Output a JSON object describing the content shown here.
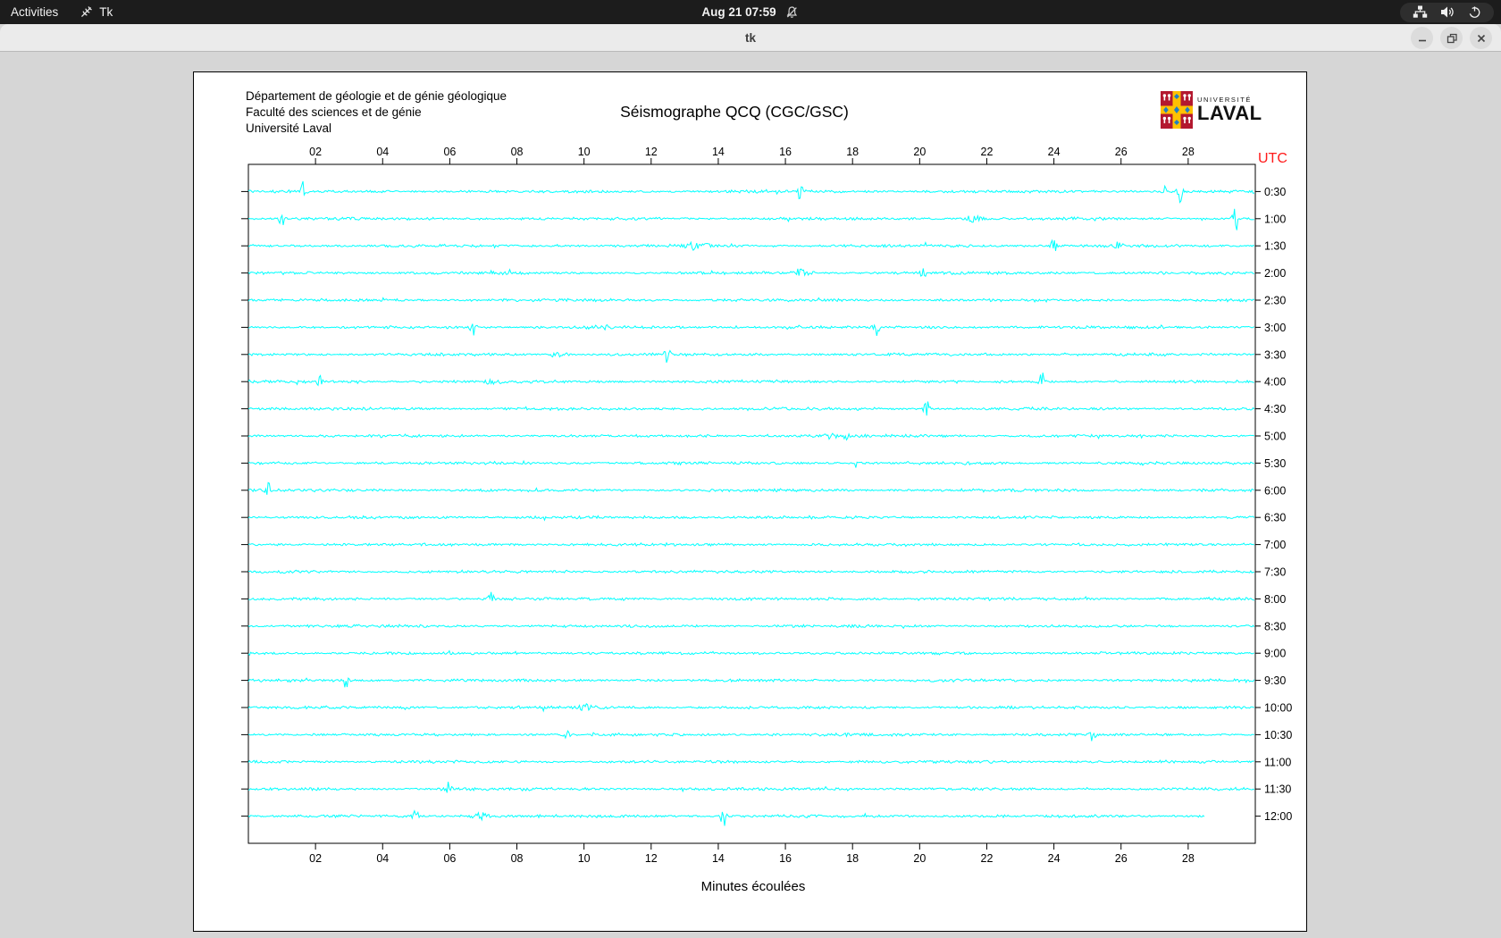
{
  "top_bar": {
    "activities": "Activities",
    "app_name": "Tk",
    "clock": "Aug 21 07:59",
    "icons": [
      "tk-feather-icon",
      "notifications-muted-icon",
      "network-wired-icon",
      "volume-icon",
      "power-icon"
    ]
  },
  "titlebar": {
    "title": "tk",
    "buttons": [
      "minimize",
      "maximize",
      "close"
    ]
  },
  "seismograph": {
    "header_lines": [
      "Département de géologie et de génie géologique",
      "Faculté des sciences et de génie",
      "Université Laval"
    ],
    "title": "Séismographe QCQ (CGC/GSC)",
    "utc_label": "UTC",
    "logo": {
      "line1": "UNIVERSITÉ",
      "line2": "LAVAL"
    },
    "colors": {
      "trace": "#00ffff",
      "axis": "#000000",
      "utc": "#ff1a1a"
    }
  },
  "chart_data": {
    "type": "line",
    "title": "Séismographe QCQ (CGC/GSC)",
    "xlabel": "Minutes écoulées",
    "x_range_minutes": [
      0,
      30
    ],
    "x_tick_minutes": [
      2,
      4,
      6,
      8,
      10,
      12,
      14,
      16,
      18,
      20,
      22,
      24,
      26,
      28
    ],
    "x_ticks": [
      "02",
      "04",
      "06",
      "08",
      "10",
      "12",
      "14",
      "16",
      "18",
      "20",
      "22",
      "24",
      "26",
      "28"
    ],
    "ylabel_right": "UTC",
    "grid": false,
    "trace_color": "#00ffff",
    "rows": [
      {
        "label": "0:30",
        "events": [
          {
            "m": 1.6,
            "amp": 13,
            "w": 2.2
          },
          {
            "m": 16.45,
            "amp": 11,
            "w": 2.2
          },
          {
            "m": 27.28,
            "amp": 9,
            "w": 2.2
          },
          {
            "m": 27.76,
            "amp": 13,
            "w": 2.2
          }
        ]
      },
      {
        "label": "1:00",
        "events": [
          {
            "m": 1.0,
            "amp": 10,
            "w": 2.2
          },
          {
            "m": 21.6,
            "amp": 3.5,
            "w": 7
          },
          {
            "m": 29.4,
            "amp": 16,
            "w": 2.4
          }
        ]
      },
      {
        "label": "1:30",
        "events": [
          {
            "m": 13.35,
            "amp": 3.5,
            "w": 9
          },
          {
            "m": 24.0,
            "amp": 10,
            "w": 2.2
          },
          {
            "m": 25.9,
            "amp": 3,
            "w": 4
          }
        ]
      },
      {
        "label": "2:00",
        "events": [
          {
            "m": 16.45,
            "amp": 4,
            "w": 8
          },
          {
            "m": 20.1,
            "amp": 9,
            "w": 2.2
          }
        ]
      },
      {
        "label": "2:30",
        "events": []
      },
      {
        "label": "3:00",
        "events": [
          {
            "m": 6.7,
            "amp": 11,
            "w": 2.2
          },
          {
            "m": 10.5,
            "amp": 3.5,
            "w": 6
          },
          {
            "m": 18.7,
            "amp": 10,
            "w": 2.2
          }
        ]
      },
      {
        "label": "3:30",
        "events": [
          {
            "m": 9.25,
            "amp": 3.5,
            "w": 6
          },
          {
            "m": 12.5,
            "amp": 12,
            "w": 2.2
          }
        ]
      },
      {
        "label": "4:00",
        "events": [
          {
            "m": 2.1,
            "amp": 11,
            "w": 2.2
          },
          {
            "m": 7.3,
            "amp": 3,
            "w": 5
          },
          {
            "m": 23.65,
            "amp": 10,
            "w": 2.2
          }
        ]
      },
      {
        "label": "4:30",
        "events": [
          {
            "m": 20.2,
            "amp": 10,
            "w": 2.2
          }
        ]
      },
      {
        "label": "5:00",
        "events": [
          {
            "m": 17.25,
            "amp": 4,
            "w": 6
          },
          {
            "m": 17.85,
            "amp": 9,
            "w": 2.2
          }
        ]
      },
      {
        "label": "5:30",
        "events": [
          {
            "m": 18.1,
            "amp": 6,
            "w": 2.2
          }
        ]
      },
      {
        "label": "6:00",
        "events": [
          {
            "m": 0.6,
            "amp": 9,
            "w": 2.2
          }
        ]
      },
      {
        "label": "6:30",
        "events": []
      },
      {
        "label": "7:00",
        "events": []
      },
      {
        "label": "7:30",
        "events": []
      },
      {
        "label": "8:00",
        "events": [
          {
            "m": 7.25,
            "amp": 9,
            "w": 2.2
          }
        ]
      },
      {
        "label": "8:30",
        "events": []
      },
      {
        "label": "9:00",
        "events": []
      },
      {
        "label": "9:30",
        "events": [
          {
            "m": 2.9,
            "amp": 9,
            "w": 2.2
          }
        ]
      },
      {
        "label": "10:00",
        "events": [
          {
            "m": 10.05,
            "amp": 3.5,
            "w": 5
          }
        ]
      },
      {
        "label": "10:30",
        "events": [
          {
            "m": 9.5,
            "amp": 9,
            "w": 2.2
          },
          {
            "m": 25.15,
            "amp": 9,
            "w": 2.2
          }
        ]
      },
      {
        "label": "11:00",
        "events": []
      },
      {
        "label": "11:30",
        "events": [
          {
            "m": 5.95,
            "amp": 8,
            "w": 2.2
          }
        ]
      },
      {
        "label": "12:00",
        "end_minute": 28.5,
        "events": [
          {
            "m": 5.0,
            "amp": 8,
            "w": 2.2
          },
          {
            "m": 6.9,
            "amp": 4,
            "w": 6
          },
          {
            "m": 14.15,
            "amp": 13,
            "w": 2.2
          }
        ]
      }
    ]
  }
}
